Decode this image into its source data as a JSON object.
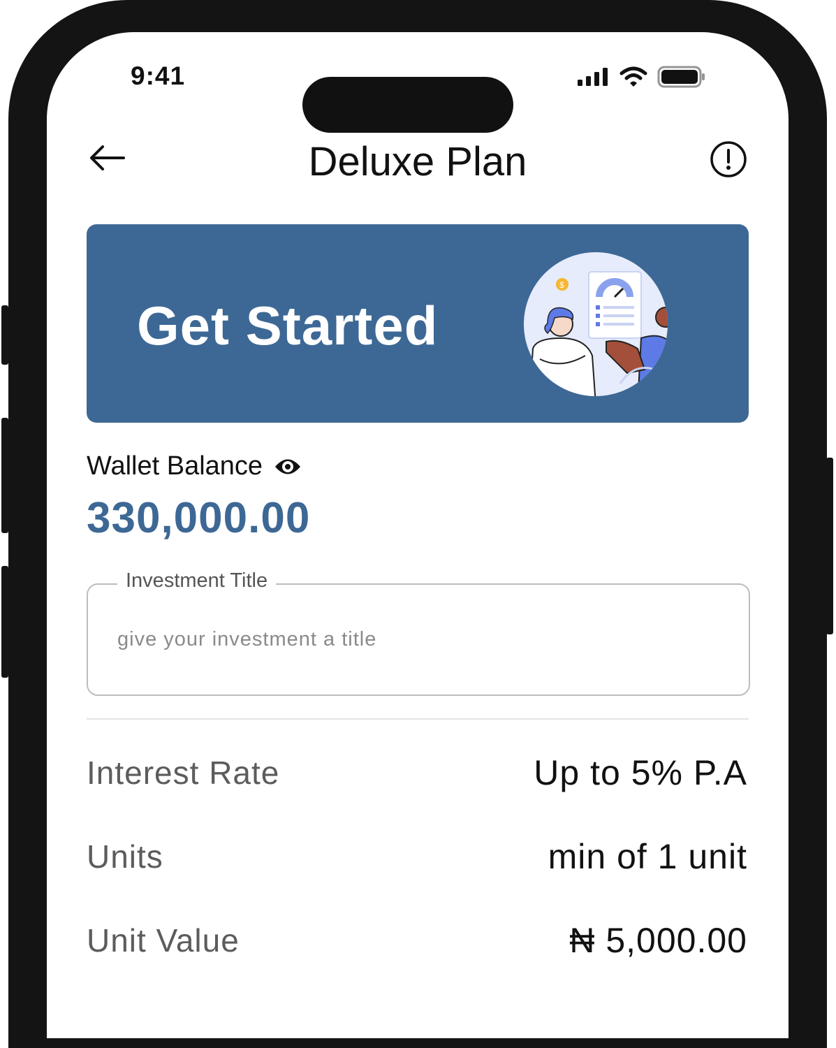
{
  "status_bar": {
    "time": "9:41",
    "icons": [
      "signal-icon",
      "wifi-icon",
      "battery-icon"
    ]
  },
  "header": {
    "title": "Deluxe Plan",
    "back_icon": "arrow-left-icon",
    "info_icon": "info-circle-icon"
  },
  "banner": {
    "title": "Get Started",
    "background": "#3d6895",
    "illustration": "investment-consultation-illustration"
  },
  "wallet": {
    "label": "Wallet Balance",
    "visibility_icon": "eye-icon",
    "amount": "330,000.00",
    "amount_color": "#3d6895"
  },
  "investment_title": {
    "label": "Investment Title",
    "value": "",
    "placeholder": "give your investment a title"
  },
  "details": [
    {
      "label": "Interest Rate",
      "value": "Up to 5% P.A"
    },
    {
      "label": "Units",
      "value": "min of 1 unit"
    },
    {
      "label": "Unit Value",
      "value": "₦ 5,000.00"
    }
  ]
}
